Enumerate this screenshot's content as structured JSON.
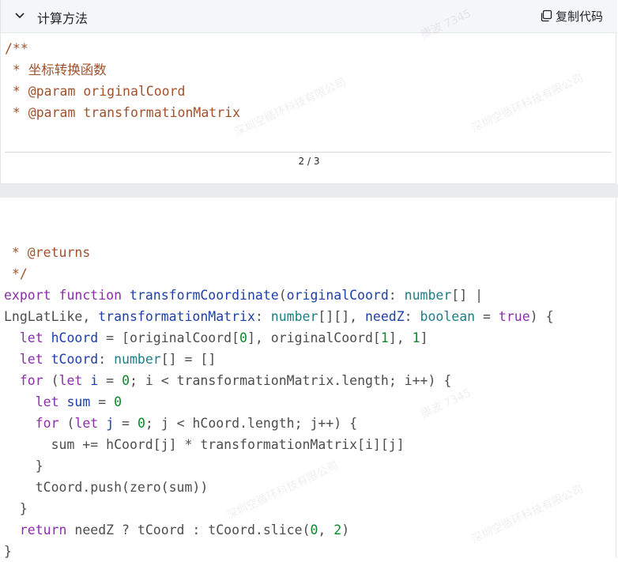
{
  "panel": {
    "title": "计算方法",
    "copy_label": "复制代码",
    "pager": "2 / 3"
  },
  "code_top": [
    "/**",
    " * 坐标转换函数",
    " * @param originalCoord",
    " * @param transformationMatrix"
  ],
  "code_bottom": [
    " * @returns",
    " */",
    "export function transformCoordinate(originalCoord: number[] |",
    "LngLatLike, transformationMatrix: number[][], needZ: boolean = true) {",
    "  let hCoord = [originalCoord[0], originalCoord[1], 1]",
    "  let tCoord: number[] = []",
    "  for (let i = 0; i < transformationMatrix.length; i++) {",
    "    let sum = 0",
    "    for (let j = 0; j < hCoord.length; j++) {",
    "      sum += hCoord[j] * transformationMatrix[i][j]",
    "    }",
    "    tCoord.push(zero(sum))",
    "  }",
    "  return needZ ? tCoord : tCoord.slice(0, 2)",
    "}"
  ],
  "watermarks": [
    "康波 7345",
    "深圳空循环科技有限公司"
  ],
  "colors": {
    "comment": "#a0522d",
    "keyword": "#8a2ea8",
    "function": "#1e3fa8",
    "type": "#1b7f86",
    "number": "#0a8a2a",
    "header_bg": "#f4f6f9"
  },
  "icons": [
    "chevron-down-icon",
    "copy-icon"
  ]
}
